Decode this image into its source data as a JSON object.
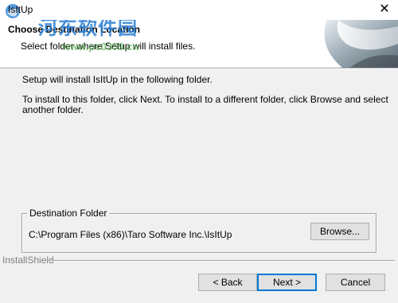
{
  "window": {
    "title": "IsItUp",
    "close_glyph": "✕"
  },
  "header": {
    "title": "Choose Destination Location",
    "subtitle": "Select folder where Setup will install files.",
    "watermark_text": "河东软件园",
    "watermark_url": "www.pc0359.cn"
  },
  "body": {
    "line1": "Setup will install IsItUp in the following folder.",
    "line2": "To install to this folder, click Next. To install to a different folder, click Browse and select",
    "line3": "another folder."
  },
  "destination": {
    "legend": "Destination Folder",
    "path": "C:\\Program Files (x86)\\Taro Software Inc.\\IsItUp",
    "browse_label": "Browse..."
  },
  "footer": {
    "brand": "InstallShield",
    "back_label": "< Back",
    "next_label": "Next >",
    "cancel_label": "Cancel"
  },
  "colors": {
    "watermark_blue": "#2a7fd4",
    "focus_border": "#0078d7"
  }
}
